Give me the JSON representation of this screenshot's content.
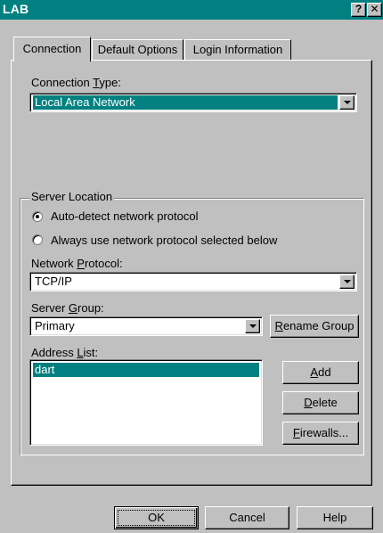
{
  "window": {
    "title": "LAB",
    "help_glyph": "?",
    "close_glyph": "✕"
  },
  "tabs": [
    {
      "label": "Connection",
      "active": true
    },
    {
      "label": "Default Options",
      "active": false
    },
    {
      "label": "Login Information",
      "active": false
    }
  ],
  "connection_type": {
    "label_pre": "Connection ",
    "label_u": "T",
    "label_post": "ype:",
    "value": "Local Area Network"
  },
  "server_location": {
    "group_label": "Server Location",
    "radio_auto": {
      "label": "Auto-detect network protocol",
      "checked": true
    },
    "radio_manual": {
      "label": "Always use network protocol selected below",
      "checked": false
    }
  },
  "network_protocol": {
    "label_pre": "Network ",
    "label_u": "P",
    "label_post": "rotocol:",
    "value": "TCP/IP"
  },
  "server_group": {
    "label_pre": "Server ",
    "label_u": "G",
    "label_post": "roup:",
    "value": "Primary",
    "rename_pre": "",
    "rename_u": "R",
    "rename_post": "ename Group"
  },
  "address_list": {
    "label_pre": "Address ",
    "label_u": "L",
    "label_post": "ist:",
    "items": [
      {
        "label": "dart",
        "selected": true
      }
    ]
  },
  "side_buttons": {
    "add_u": "A",
    "add_post": "dd",
    "delete_u": "D",
    "delete_post": "elete",
    "firewalls_u": "F",
    "firewalls_post": "irewalls..."
  },
  "footer_buttons": {
    "ok": "OK",
    "cancel": "Cancel",
    "help": "Help"
  },
  "colors": {
    "face": "#c0c0c0",
    "titlebar": "#008080",
    "selection": "#008080"
  }
}
